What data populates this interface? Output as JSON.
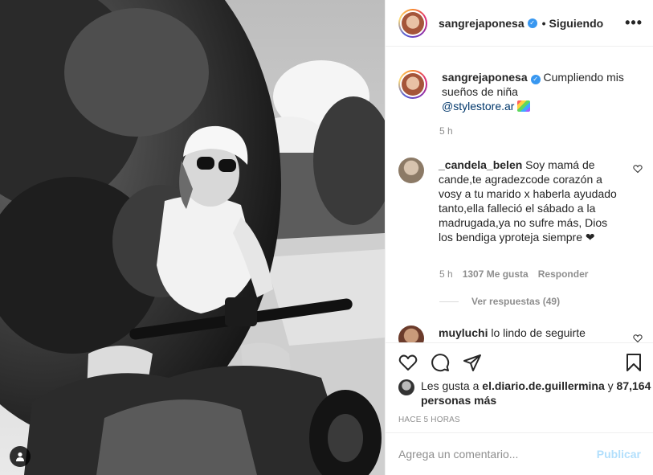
{
  "post": {
    "author": "sangrejaponesa",
    "verified_icon": "verified-badge-icon",
    "separator": "•",
    "follow_status": "Siguiendo",
    "more_icon": "ellipsis-icon",
    "more_label": "•••"
  },
  "caption": {
    "author": "sangrejaponesa",
    "text": "Cumpliendo mis sueños de niña",
    "mention": "@stylestore.ar",
    "time": "5 h"
  },
  "comments": [
    {
      "author": "_candela_belen",
      "text": "Soy mamá de cande,te agradezcode corazón a vosy a tu marido x haberla ayudado tanto,ella falleció el sábado a la madrugada,ya no sufre más, Dios los bendiga yproteja siempre",
      "heart_emoji": "❤",
      "time": "5 h",
      "likes": "1307 Me gusta",
      "reply": "Responder",
      "view_replies": "Ver respuestas (49)"
    },
    {
      "author": "muyluchi",
      "text": "lo lindo de seguirte"
    }
  ],
  "likes": {
    "prefix": "Les gusta a",
    "user": "el.diario.de.guillermina",
    "conjunction": "y",
    "others": "87,164 personas más"
  },
  "posted": "Hace 5 horas",
  "comment_box": {
    "placeholder": "Agrega un comentario...",
    "submit": "Publicar"
  },
  "colors": {
    "link": "#00376b",
    "verified": "#3897f0",
    "muted": "#8e8e8e",
    "submit_disabled": "#b2dffc"
  }
}
